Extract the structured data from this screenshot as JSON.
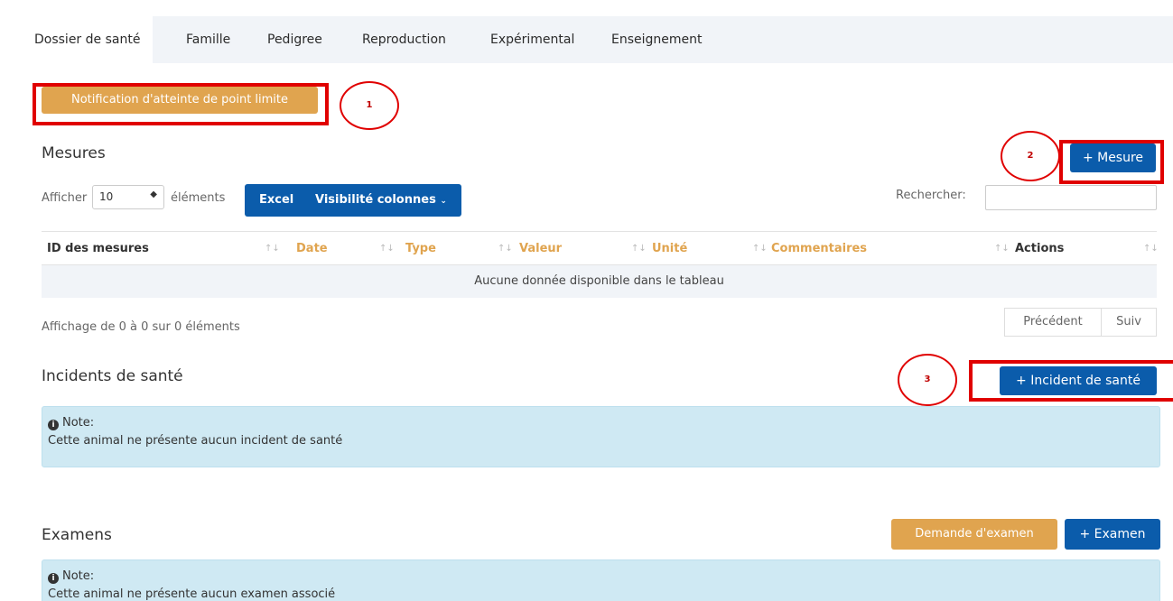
{
  "tabs": [
    "Dossier de santé",
    "Famille",
    "Pedigree",
    "Reproduction",
    "Expérimental",
    "Enseignement"
  ],
  "notification_button": "Notification d'atteinte de point limite",
  "annotations": [
    "1",
    "2",
    "3"
  ],
  "mesures": {
    "title": "Mesures",
    "add_button": "+ Mesure",
    "show_label": "Afficher",
    "page_size": "10",
    "elements_label": "éléments",
    "excel_button": "Excel",
    "visibility_button": "Visibilité colonnes",
    "search_label": "Rechercher:",
    "columns": [
      "ID des mesures",
      "Date",
      "Type",
      "Valeur",
      "Unité",
      "Commentaires",
      "Actions"
    ],
    "empty_message": "Aucune donnée disponible dans le tableau",
    "info": "Affichage de 0 à 0 sur 0 éléments",
    "prev_button": "Précédent",
    "next_button": "Suiv"
  },
  "incidents": {
    "title": "Incidents de santé",
    "add_button": "+ Incident de santé",
    "note_label": "Note:",
    "note_text": "Cette animal ne présente aucun incident de santé"
  },
  "examens": {
    "title": "Examens",
    "request_button": "Demande d'examen",
    "add_button": "+ Examen",
    "note_label": "Note:",
    "note_text": "Cette animal ne présente aucun examen associé"
  },
  "colors": {
    "accent_blue": "#0b5cab",
    "accent_orange": "#e0a44f",
    "annotation_red": "#e00000",
    "note_bg": "#cfe9f3"
  }
}
